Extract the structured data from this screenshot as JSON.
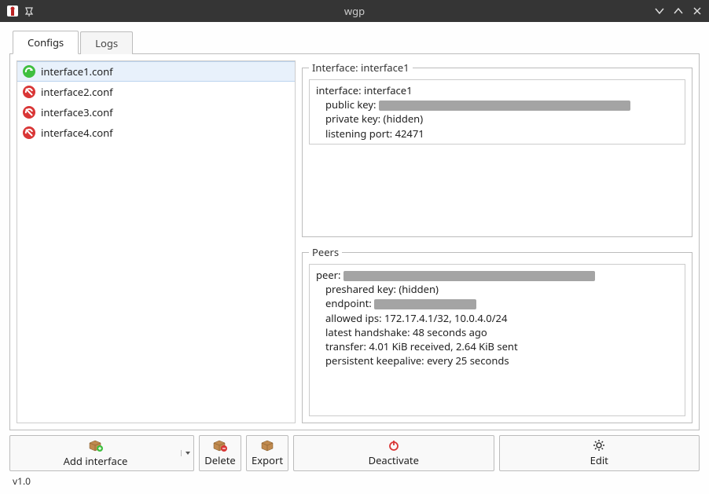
{
  "window": {
    "title": "wgp"
  },
  "tabs": {
    "configs": "Configs",
    "logs": "Logs"
  },
  "configs": {
    "items": [
      {
        "name": "interface1.conf",
        "active": true,
        "selected": true
      },
      {
        "name": "interface2.conf",
        "active": false,
        "selected": false
      },
      {
        "name": "interface3.conf",
        "active": false,
        "selected": false
      },
      {
        "name": "interface4.conf",
        "active": false,
        "selected": false
      }
    ]
  },
  "interface": {
    "group_title": "Interface: interface1",
    "lines": {
      "interface_label": "interface:",
      "interface_value": "interface1",
      "pubkey_label": "public key:",
      "pubkey_value": "",
      "privkey_label": "private key:",
      "privkey_value": "(hidden)",
      "port_label": "listening port:",
      "port_value": "42471"
    }
  },
  "peers": {
    "group_title": "Peers",
    "lines": {
      "peer_label": "peer:",
      "peer_value": "",
      "psk_label": "preshared key:",
      "psk_value": "(hidden)",
      "endpoint_label": "endpoint:",
      "endpoint_value": "",
      "allowed_label": "allowed ips:",
      "allowed_value": "172.17.4.1/32, 10.0.4.0/24",
      "handshake_label": "latest handshake:",
      "handshake_value": "48 seconds ago",
      "transfer_label": "transfer:",
      "transfer_value": "4.01 KiB received, 2.64 KiB sent",
      "keepalive_label": "persistent keepalive:",
      "keepalive_value": "every 25 seconds"
    }
  },
  "buttons": {
    "add_interface": "Add interface",
    "delete": "Delete",
    "export": "Export",
    "deactivate": "Deactivate",
    "edit": "Edit"
  },
  "footer": {
    "version": "v1.0"
  }
}
